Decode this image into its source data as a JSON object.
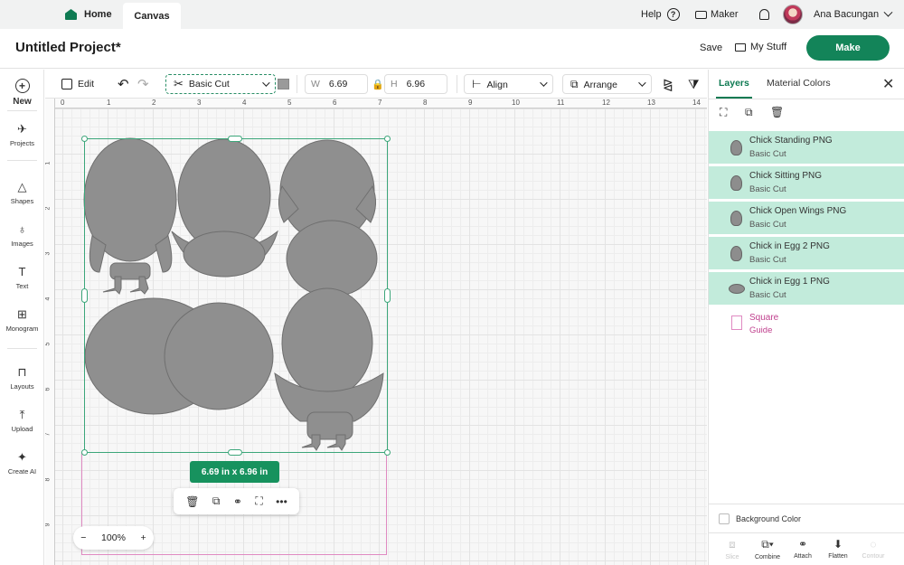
{
  "topbar": {
    "home_label": "Home",
    "canvas_label": "Canvas",
    "help_label": "Help",
    "help_icon": "?",
    "maker_label": "Maker",
    "user_name": "Ana Bacungan"
  },
  "project": {
    "title": "Untitled Project*",
    "save_label": "Save",
    "mystuff_label": "My Stuff",
    "make_label": "Make",
    "make_color": "#138459"
  },
  "sidebar": {
    "items": [
      {
        "label": "New",
        "icon": "plus-circle-icon",
        "glyph": "+"
      },
      {
        "label": "Projects",
        "icon": "rocket-icon",
        "glyph": "✈"
      },
      {
        "label": "Shapes",
        "icon": "shapes-icon",
        "glyph": "△"
      },
      {
        "label": "Images",
        "icon": "bulb-icon",
        "glyph": "♁"
      },
      {
        "label": "Text",
        "icon": "text-icon",
        "glyph": "T"
      },
      {
        "label": "Monogram",
        "icon": "monogram-icon",
        "glyph": "⊞"
      },
      {
        "label": "Layouts",
        "icon": "shirt-icon",
        "glyph": "⊓"
      },
      {
        "label": "Upload",
        "icon": "upload-icon",
        "glyph": "⤒"
      },
      {
        "label": "Create AI",
        "icon": "sparkle-icon",
        "glyph": "✦"
      }
    ]
  },
  "toolbar": {
    "edit_label": "Edit",
    "undo_glyph": "↶",
    "redo_glyph": "↷",
    "operation": "Basic Cut",
    "scissors_glyph": "✂",
    "swatch_color": "#9a9a9a",
    "w_key": "W",
    "w_value": "6.69",
    "lock_glyph": "🔒",
    "h_key": "H",
    "h_value": "6.96",
    "align_label": "Align",
    "align_glyph": "⊢",
    "arrange_label": "Arrange",
    "arrange_glyph": "⧉",
    "flip_h_glyph": "⧎",
    "flip_v_glyph": "⧩"
  },
  "ruler": {
    "top": [
      "0",
      "1",
      "2",
      "3",
      "4",
      "5",
      "6",
      "7",
      "8",
      "9",
      "10",
      "11",
      "12",
      "13",
      "14"
    ],
    "left": [
      "1",
      "2",
      "3",
      "4",
      "5",
      "6",
      "7",
      "8",
      "9"
    ]
  },
  "canvas": {
    "dimension_badge": "6.69  in x 6.96  in",
    "actions": [
      "🗑",
      "⧉",
      "⚭",
      "⛶",
      "•••"
    ],
    "zoom_minus": "−",
    "zoom_value": "100%",
    "zoom_plus": "+",
    "shape_color": "#8f8f8f",
    "selection_color": "#3ca67a",
    "guide_color": "#e08ac2"
  },
  "panel": {
    "tab_layers": "Layers",
    "tab_material": "Material Colors",
    "close_glyph": "✕",
    "action_icons": [
      "⛶",
      "⧉",
      "🗑"
    ],
    "layers": [
      {
        "name": "Chick Standing PNG",
        "sub": "Basic Cut"
      },
      {
        "name": "Chick Sitting PNG",
        "sub": "Basic Cut"
      },
      {
        "name": "Chick Open Wings PNG",
        "sub": "Basic Cut"
      },
      {
        "name": "Chick in Egg 2 PNG",
        "sub": "Basic Cut"
      },
      {
        "name": "Chick in Egg 1 PNG",
        "sub": "Basic Cut"
      }
    ],
    "guide_layer": {
      "name": "Square",
      "sub": "Guide"
    },
    "background_color_label": "Background Color",
    "bottom_tools": [
      {
        "label": "Slice",
        "glyph": "⧈",
        "disabled": true
      },
      {
        "label": "Combine",
        "glyph": "⧉▾",
        "disabled": false
      },
      {
        "label": "Attach",
        "glyph": "⚭",
        "disabled": false
      },
      {
        "label": "Flatten",
        "glyph": "⬇",
        "disabled": false
      },
      {
        "label": "Contour",
        "glyph": "◌",
        "disabled": true
      }
    ],
    "layer_bg": "#c2ebdb"
  }
}
